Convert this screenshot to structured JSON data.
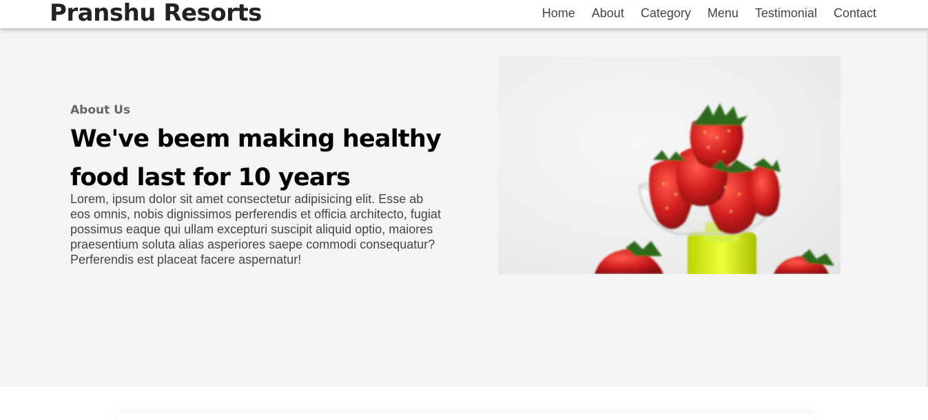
{
  "header": {
    "logo": "Pranshu Resorts",
    "nav": [
      "Home",
      "About",
      "Category",
      "Menu",
      "Testimonial",
      "Contact"
    ]
  },
  "about": {
    "eyebrow": "About Us",
    "headline": "We've beem making healthy food last for 10 years",
    "body": "Lorem, ipsum dolor sit amet consectetur adipisicing elit. Esse ab eos omnis, nobis dignissimos perferendis et officia architecto, fugiat possimus eaque qui ullam excepturi suscipit aliquid optio, maiores praesentium soluta alias asperiores saepe commodi consequatur? Perferendis est placeat facere aspernatur!"
  },
  "colors": {
    "section_bg": "#f4f4f6",
    "accent_red": "#d21f1f",
    "leaf_green": "#2f6b1f"
  }
}
